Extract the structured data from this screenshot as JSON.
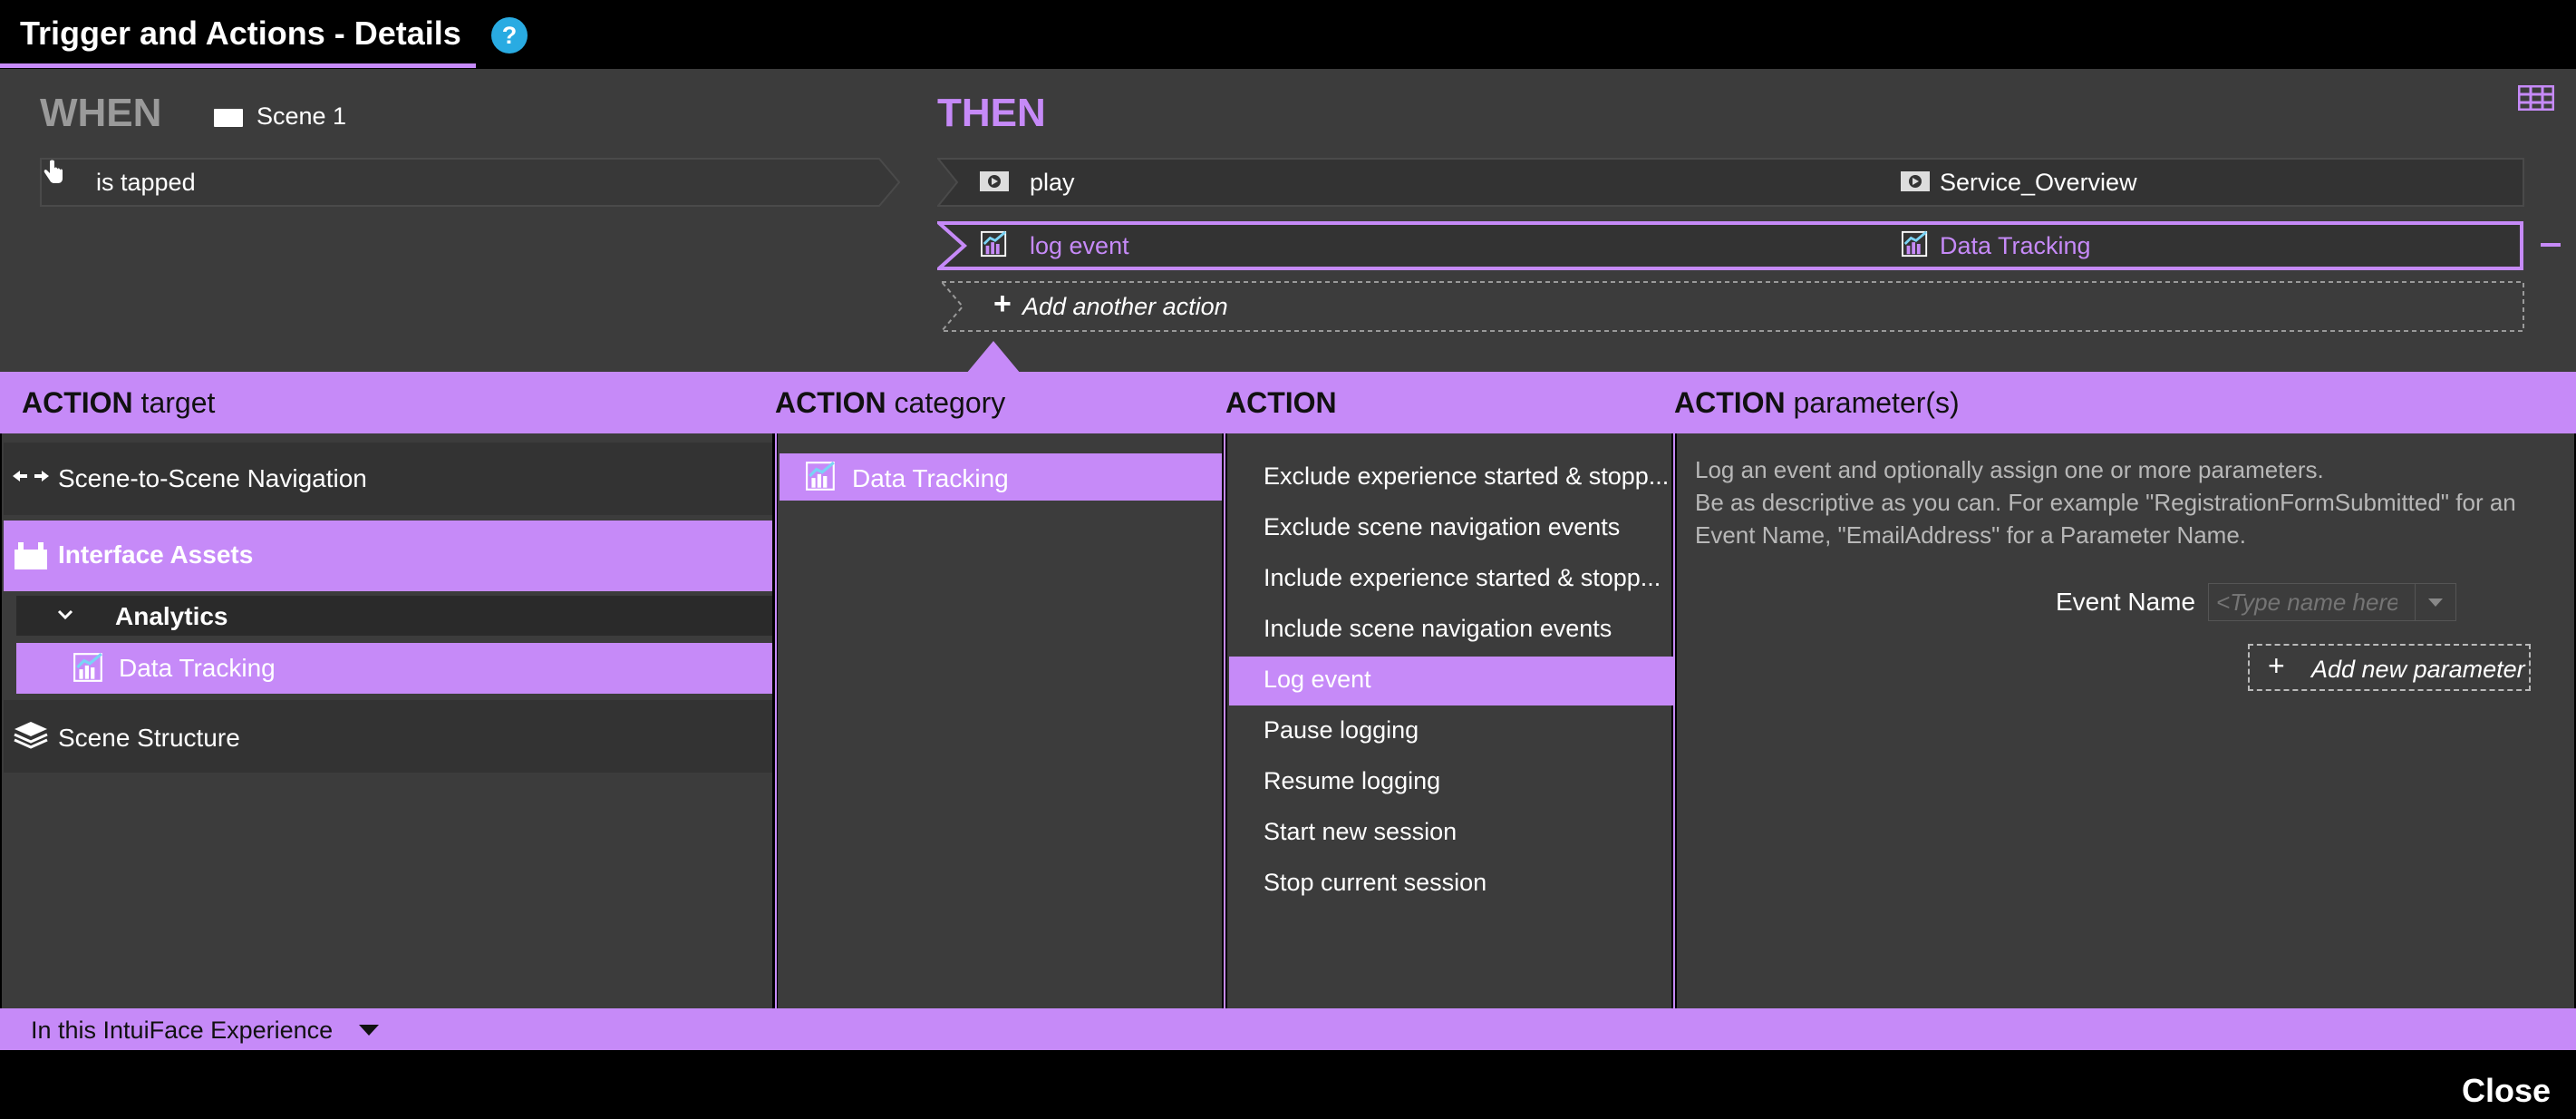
{
  "window": {
    "title": "Trigger and Actions - Details",
    "help_label": "?"
  },
  "when": {
    "label": "WHEN",
    "source": "Scene 1",
    "trigger": "is tapped"
  },
  "then": {
    "label": "THEN",
    "actions": [
      {
        "verb": "play",
        "target": "Service_Overview",
        "selected": false
      },
      {
        "verb": "log event",
        "target": "Data Tracking",
        "selected": true
      }
    ],
    "add_action": "Add another action"
  },
  "columns": {
    "target": {
      "bold": "ACTION",
      "rest": "target"
    },
    "category": {
      "bold": "ACTION",
      "rest": "category"
    },
    "action": {
      "bold": "ACTION",
      "rest": ""
    },
    "params": {
      "bold": "ACTION",
      "rest": "parameter(s)"
    }
  },
  "targets": {
    "scene_nav": "Scene-to-Scene Navigation",
    "interface_assets": "Interface Assets",
    "analytics": "Analytics",
    "data_tracking": "Data Tracking",
    "scene_structure": "Scene Structure"
  },
  "category": {
    "selected": "Data Tracking"
  },
  "actions_list": [
    "Exclude experience started & stopp...",
    "Exclude scene navigation events",
    "Include experience started & stopp...",
    "Include scene navigation events",
    "Log event",
    "Pause logging",
    "Resume logging",
    "Start new session",
    "Stop current session"
  ],
  "params": {
    "desc_line1": "Log an event and optionally assign one or more parameters.",
    "desc_line2": "Be as descriptive as you can. For example \"RegistrationFormSubmitted\" for an",
    "desc_line3": "Event Name, \"EmailAddress\" for a Parameter Name.",
    "event_name_label": "Event Name",
    "event_name_placeholder": "<Type name here>",
    "add_param": "Add new parameter"
  },
  "footer": {
    "scope": "In this IntuiFace Experience",
    "close": "Close"
  },
  "colors": {
    "accent": "#c68af8",
    "help": "#29abe2",
    "panel": "#3c3c3c"
  },
  "icons": [
    "help-icon",
    "scene-icon",
    "grid-icon",
    "hand-icon",
    "video-icon",
    "chart-icon",
    "plus-icon",
    "arrows-icon",
    "toolbox-icon",
    "chevron-down-icon",
    "layers-icon",
    "minus-icon",
    "dropdown-caret-icon"
  ]
}
